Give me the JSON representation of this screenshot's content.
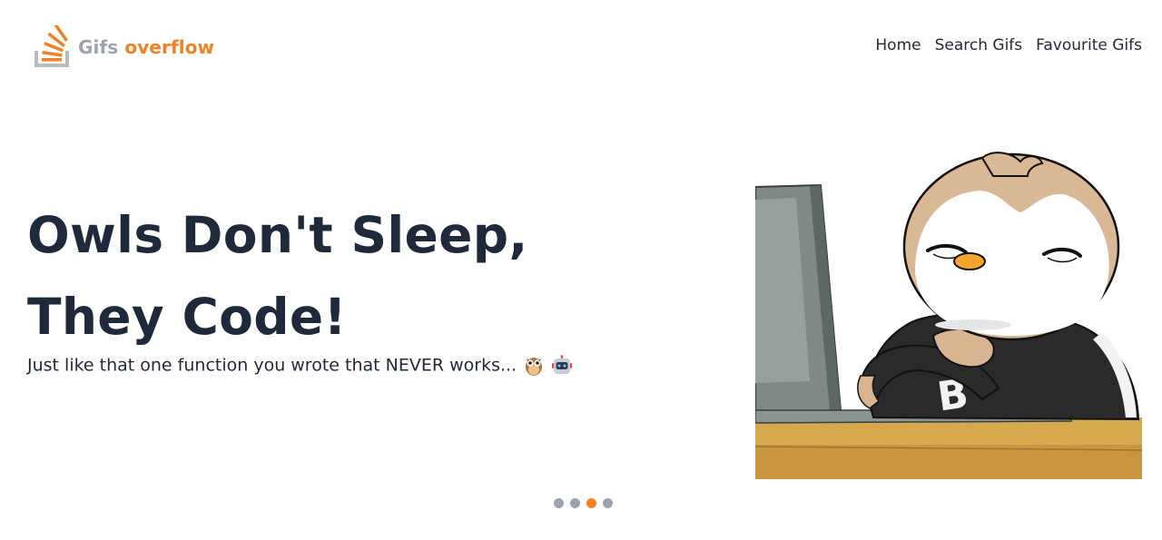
{
  "brand": {
    "name_part1": "Gifs",
    "name_part2": "overflow",
    "logo_icon": "stack-overflow-icon",
    "accent_color": "#f48024"
  },
  "nav": {
    "items": [
      {
        "label": "Home"
      },
      {
        "label": "Search Gifs"
      },
      {
        "label": "Favourite Gifs"
      }
    ]
  },
  "hero": {
    "title": "Owls Don't Sleep, They Code!",
    "subtitle": "Just like that one function you wrote that NEVER works...",
    "emojis": [
      "owl-emoji",
      "robot-emoji"
    ]
  },
  "carousel": {
    "slide_count": 4,
    "active_index": 3
  }
}
